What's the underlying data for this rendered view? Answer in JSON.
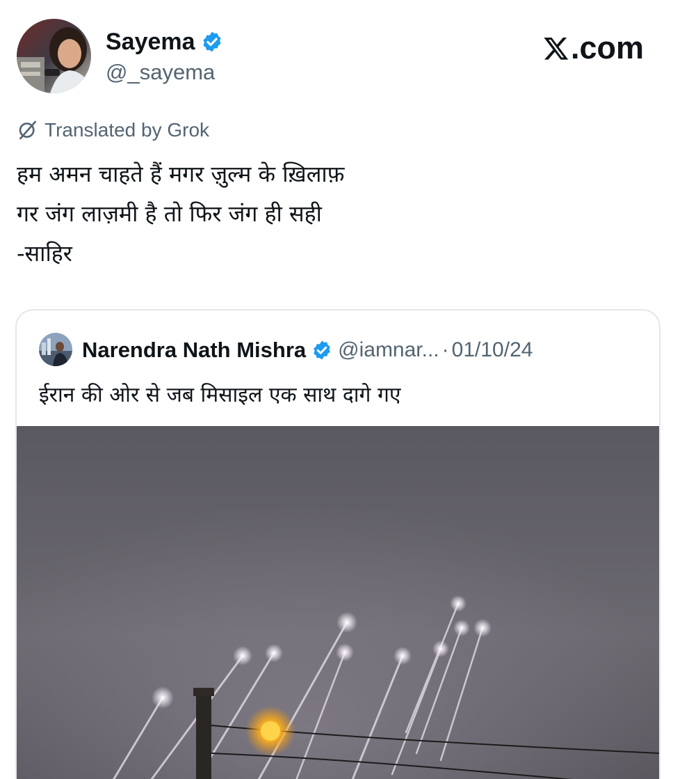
{
  "post": {
    "author": {
      "display_name": "Sayema",
      "handle": "@_sayema",
      "verified": true,
      "avatar": "avatar-photo"
    },
    "site_label": "X.com",
    "translation_notice": "Translated by Grok",
    "text_lines": [
      "हम अमन चाहते हैं मगर ज़ुल्म के ख़िलाफ़",
      "गर जंग लाज़मी है तो फिर जंग ही सही",
      "-साहिर"
    ]
  },
  "quoted_post": {
    "author": {
      "display_name": "Narendra Nath Mishra",
      "handle": "@iamnar...",
      "verified": true,
      "avatar": "avatar-photo"
    },
    "separator": "·",
    "date": "01/10/24",
    "text": "ईरान की ओर से जब मिसाइल एक साथ दागे गए",
    "media": "night-sky-missile-launch-photo"
  },
  "colors": {
    "text_primary": "#0f1419",
    "text_secondary": "#536471",
    "verified_blue": "#1d9bf0",
    "card_border": "#e3e7ea"
  }
}
